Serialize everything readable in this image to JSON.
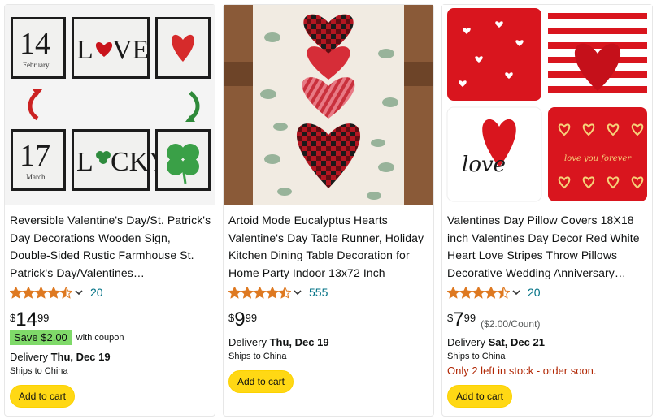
{
  "colors": {
    "star": "#de7921",
    "link": "#007185",
    "coupon": "#7fda69",
    "add_to_cart": "#ffd814",
    "stock_warning": "#b12704"
  },
  "products": [
    {
      "image": {
        "icon": "reversible-sign-image",
        "top_date_day": "14",
        "top_date_month": "February",
        "top_word_start": "L",
        "top_word_end": "VE",
        "bottom_date_day": "17",
        "bottom_date_month": "March",
        "bottom_word_start": "L",
        "bottom_word_end": "CKY"
      },
      "title": "Reversible Valentine's Day/St. Patrick's Day Decorations Wooden Sign, Double-Sided Rustic Farmhouse St. Patrick's Day/Valentines…",
      "rating": 4.5,
      "reviews": "20",
      "price": {
        "symbol": "$",
        "whole": "14",
        "fraction": "99"
      },
      "coupon": {
        "badge": "Save $2.00",
        "text": "with coupon"
      },
      "delivery_label": "Delivery",
      "delivery_date": "Thu, Dec 19",
      "ships_to": "Ships to China",
      "button": "Add to cart"
    },
    {
      "image": {
        "icon": "table-runner-image"
      },
      "title": "Artoid Mode Eucalyptus Hearts Valentine's Day Table Runner, Holiday Kitchen Dining Table Decoration for Home Party Indoor 13x72 Inch",
      "rating": 4.5,
      "reviews": "555",
      "price": {
        "symbol": "$",
        "whole": "9",
        "fraction": "99"
      },
      "delivery_label": "Delivery",
      "delivery_date": "Thu, Dec 19",
      "ships_to": "Ships to China",
      "button": "Add to cart"
    },
    {
      "image": {
        "icon": "pillow-covers-image",
        "pillow_script": "love",
        "pillow_small_script": "love you forever"
      },
      "title": "Valentines Day Pillow Covers 18X18 inch Valentines Day Decor Red White Heart Love Stripes Throw Pillows Decorative Wedding Anniversary…",
      "rating": 4.5,
      "reviews": "20",
      "price": {
        "symbol": "$",
        "whole": "7",
        "fraction": "99",
        "unit": "($2.00/Count)"
      },
      "delivery_label": "Delivery",
      "delivery_date": "Sat, Dec 21",
      "ships_to": "Ships to China",
      "stock": "Only 2 left in stock - order soon.",
      "button": "Add to cart"
    }
  ]
}
